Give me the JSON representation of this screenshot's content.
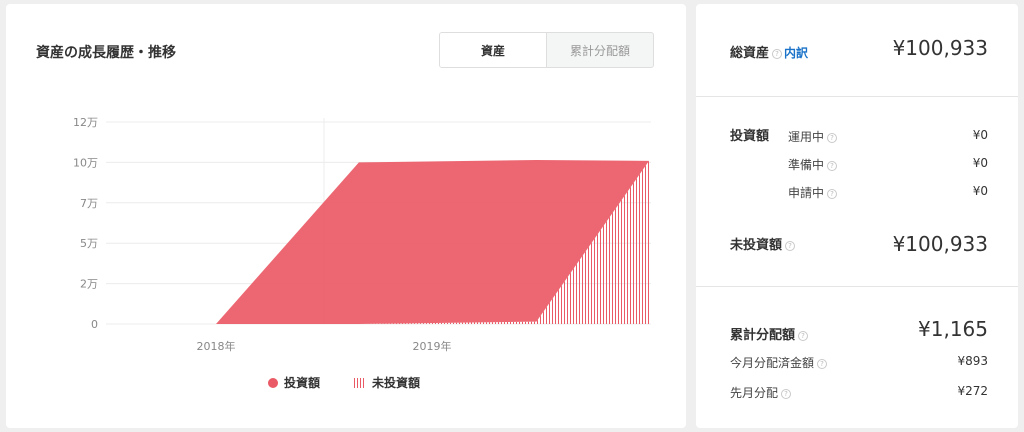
{
  "chart_panel": {
    "title": "資産の成長履歴・推移",
    "toggle": {
      "active": "資産",
      "inactive": "累計分配額"
    }
  },
  "chart_data": {
    "type": "area",
    "x_ticks": [
      "2018年",
      "2019年"
    ],
    "y_ticks": [
      "0",
      "2万",
      "5万",
      "7万",
      "10万",
      "12万"
    ],
    "ylim": [
      0,
      125000
    ],
    "grid": true,
    "legend": "bottom-center",
    "series": [
      {
        "name": "投資額",
        "style": "solid",
        "color": "#ea5a66"
      },
      {
        "name": "未投資額",
        "style": "hatched",
        "color": "#ea5a66"
      }
    ],
    "points": [
      {
        "pos": 0.0,
        "invested": 0,
        "uninvested": 0
      },
      {
        "pos": 0.33,
        "invested": 100000,
        "uninvested": 0
      },
      {
        "pos": 0.74,
        "invested": 100000,
        "uninvested": 1500
      },
      {
        "pos": 1.0,
        "invested": 0,
        "uninvested": 100933
      }
    ]
  },
  "summary": {
    "total": {
      "label": "総資産",
      "link": "内訳",
      "value": "¥100,933"
    },
    "invested": {
      "label": "投資額",
      "items": [
        {
          "label": "運用中",
          "value": "¥0"
        },
        {
          "label": "準備中",
          "value": "¥0"
        },
        {
          "label": "申請中",
          "value": "¥0"
        }
      ]
    },
    "uninvested": {
      "label": "未投資額",
      "value": "¥100,933"
    },
    "dividends": {
      "label": "累計分配額",
      "value": "¥1,165",
      "items": [
        {
          "label": "今月分配済金額",
          "value": "¥893"
        },
        {
          "label": "先月分配",
          "value": "¥272"
        }
      ]
    }
  },
  "colors": {
    "accent": "#ea5a66",
    "link": "#1a73c8"
  }
}
